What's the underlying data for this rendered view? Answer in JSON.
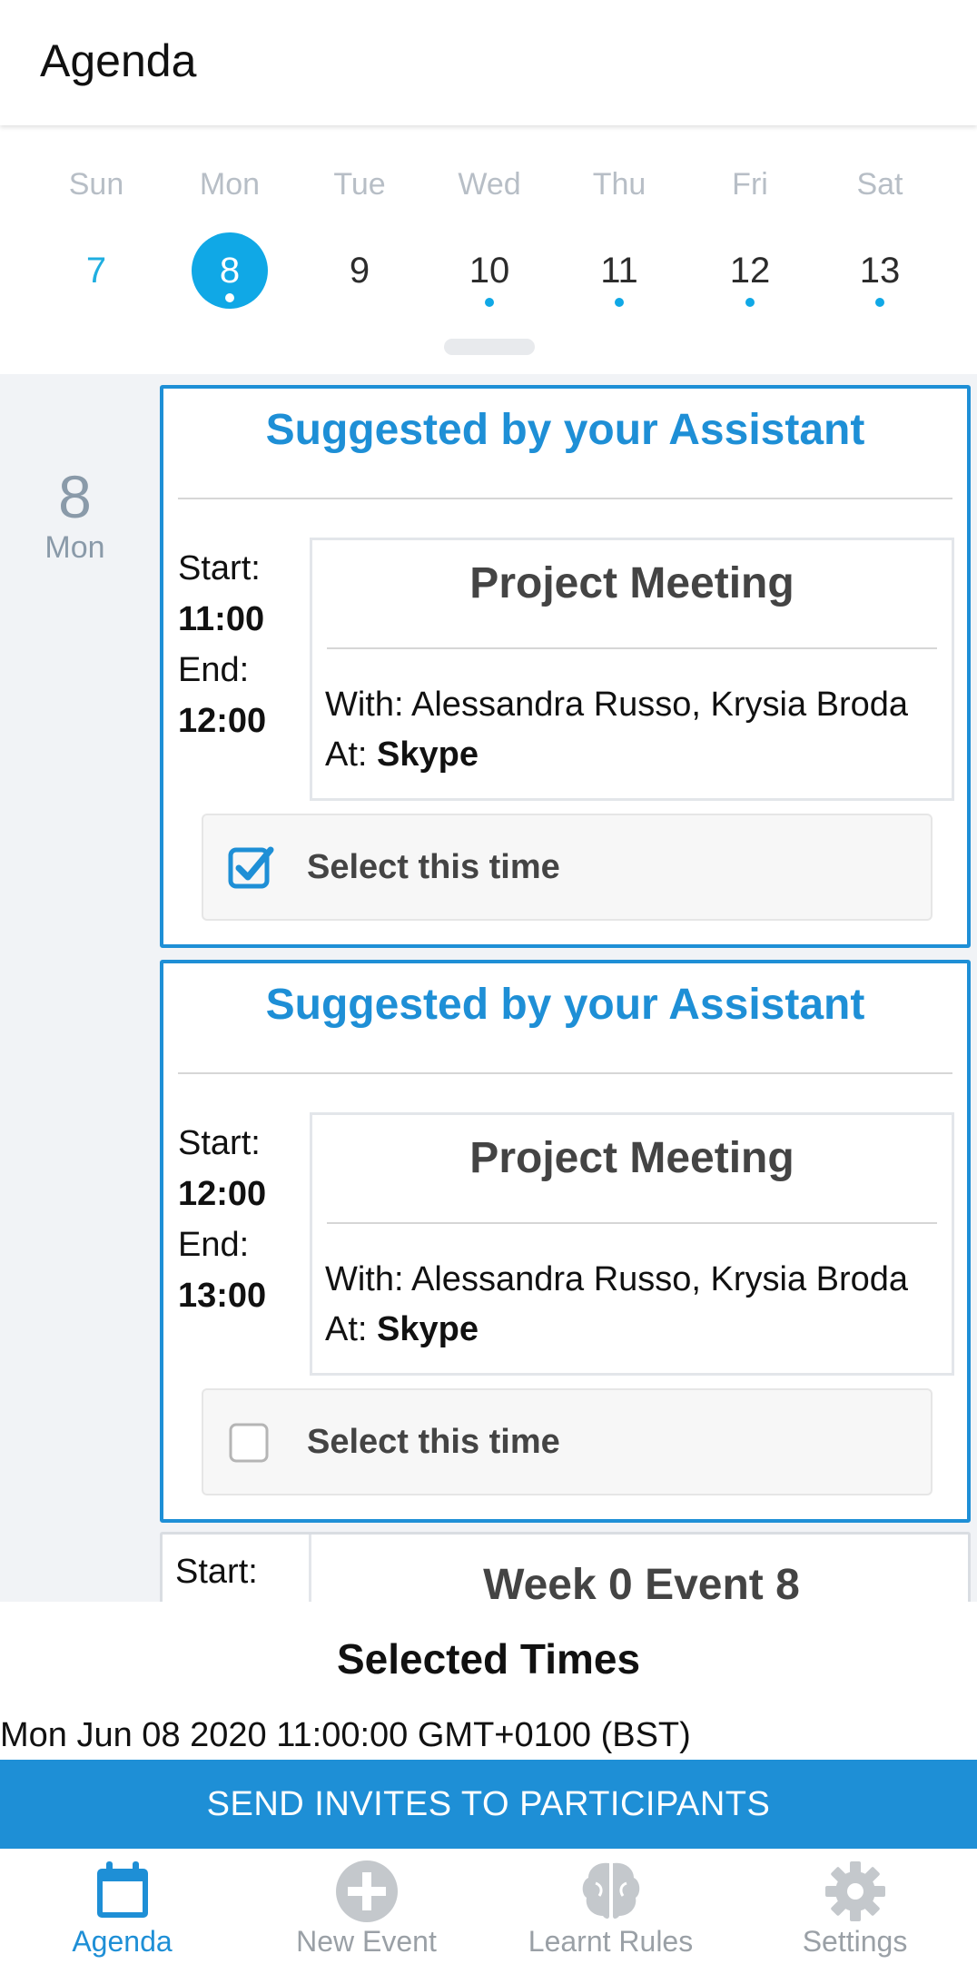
{
  "header": {
    "title": "Agenda"
  },
  "week": {
    "days": [
      {
        "name": "Sun",
        "num": "7"
      },
      {
        "name": "Mon",
        "num": "8"
      },
      {
        "name": "Tue",
        "num": "9"
      },
      {
        "name": "Wed",
        "num": "10"
      },
      {
        "name": "Thu",
        "num": "11"
      },
      {
        "name": "Fri",
        "num": "12"
      },
      {
        "name": "Sat",
        "num": "13"
      }
    ]
  },
  "agenda": {
    "day_num": "8",
    "day_name": "Mon",
    "suggestions": [
      {
        "heading": "Suggested by your Assistant",
        "start_label": "Start:",
        "start": "11:00",
        "end_label": "End:",
        "end": "12:00",
        "title": "Project Meeting",
        "with": "With: Alessandra Russo, Krysia Broda",
        "at_label": "At: ",
        "at": "Skype",
        "select_label": "Select this time",
        "checked": true
      },
      {
        "heading": "Suggested by your Assistant",
        "start_label": "Start:",
        "start": "12:00",
        "end_label": "End:",
        "end": "13:00",
        "title": "Project Meeting",
        "with": "With: Alessandra Russo, Krysia Broda",
        "at_label": "At: ",
        "at": "Skype",
        "select_label": "Select this time",
        "checked": false
      }
    ],
    "event3": {
      "start_label": "Start:",
      "title": "Week 0 Event 8"
    }
  },
  "selected": {
    "title": "Selected Times",
    "times": [
      "Mon Jun 08 2020 11:00:00 GMT+0100 (BST)"
    ],
    "send_label": "SEND INVITES TO PARTICIPANTS"
  },
  "nav": {
    "tabs": [
      {
        "label": "Agenda",
        "icon": "calendar-icon",
        "active": true
      },
      {
        "label": "New Event",
        "icon": "plus-circle-icon",
        "active": false
      },
      {
        "label": "Learnt Rules",
        "icon": "brain-icon",
        "active": false
      },
      {
        "label": "Settings",
        "icon": "gear-icon",
        "active": false
      }
    ]
  },
  "colors": {
    "accent": "#1e8fd6",
    "selected_day": "#10a8e6",
    "list_bg": "#f1f3f6"
  }
}
